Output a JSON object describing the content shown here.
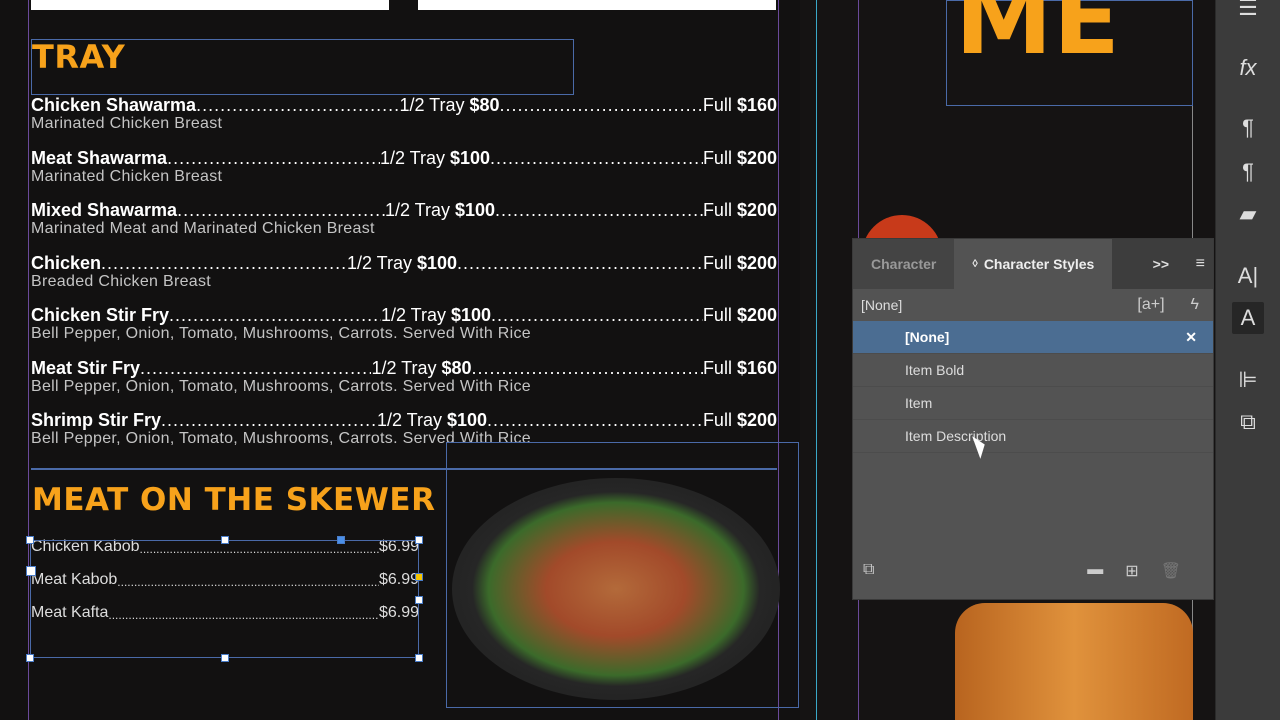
{
  "colors": {
    "accent": "#f7a21b",
    "selection": "#4b6d92"
  },
  "menu": {
    "tray_heading": "TRAY",
    "tray_items": [
      {
        "name": "Chicken Shawarma",
        "half_label": "1/2 Tray",
        "half_price": "$80",
        "full_label": "Full",
        "full_price": "$160",
        "desc": "Marinated Chicken Breast"
      },
      {
        "name": "Meat Shawarma",
        "half_label": "1/2 Tray",
        "half_price": "$100",
        "full_label": "Full",
        "full_price": "$200",
        "desc": "Marinated Chicken Breast"
      },
      {
        "name": "Mixed Shawarma",
        "half_label": "1/2 Tray",
        "half_price": "$100",
        "full_label": "Full",
        "full_price": "$200",
        "desc": "Marinated Meat and Marinated Chicken Breast"
      },
      {
        "name": "Chicken",
        "half_label": "1/2 Tray",
        "half_price": "$100",
        "full_label": "Full",
        "full_price": "$200",
        "desc": "Breaded Chicken Breast"
      },
      {
        "name": "Chicken Stir Fry",
        "half_label": "1/2 Tray",
        "half_price": "$100",
        "full_label": "Full",
        "full_price": "$200",
        "desc": "Bell Pepper, Onion, Tomato, Mushrooms, Carrots. Served With Rice"
      },
      {
        "name": "Meat Stir Fry",
        "half_label": "1/2 Tray",
        "half_price": "$80",
        "full_label": "Full",
        "full_price": "$160",
        "desc": "Bell Pepper, Onion, Tomato, Mushrooms, Carrots. Served With Rice"
      },
      {
        "name": "Shrimp Stir Fry",
        "half_label": "1/2 Tray",
        "half_price": "$100",
        "full_label": "Full",
        "full_price": "$200",
        "desc": "Bell Pepper, Onion, Tomato, Mushrooms, Carrots. Served With Rice"
      }
    ],
    "skewer_heading": "MEAT ON THE SKEWER",
    "skewer_items": [
      {
        "name": "Chicken Kabob",
        "price": "$6.99"
      },
      {
        "name": "Meat Kabob",
        "price": "$6.99"
      },
      {
        "name": "Meat Kafta",
        "price": "$6.99"
      }
    ],
    "big_title": "ME"
  },
  "panel": {
    "tab_character": "Character",
    "tab_character_styles": "Character Styles",
    "current_style": "[None]",
    "styles": [
      "[None]",
      "Item Bold",
      "Item",
      "Item Description"
    ],
    "selected_index": 0
  },
  "toolbar": {
    "icons": [
      "stroke-icon",
      "fx-icon",
      "paragraph-icon",
      "paragraph-styles-icon",
      "cc-libraries-icon",
      "character-icon",
      "character-styles-icon",
      "align-icon",
      "pathfinder-icon"
    ]
  }
}
